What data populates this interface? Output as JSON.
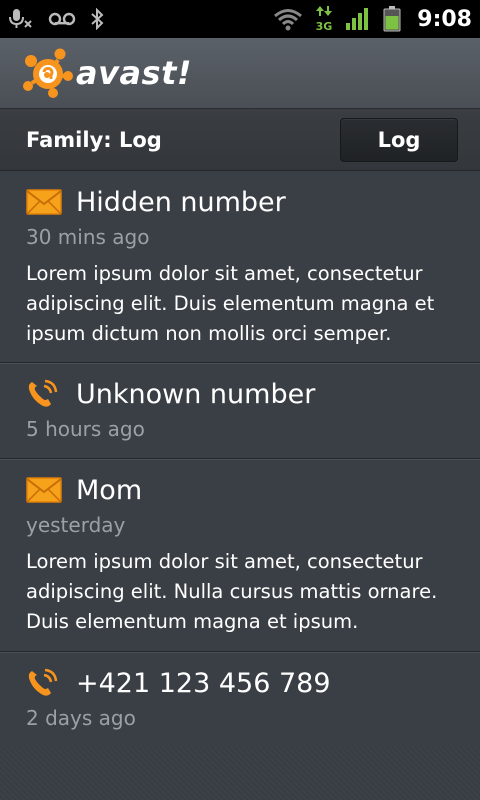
{
  "status_bar": {
    "time": "9:08",
    "network": "3G",
    "icons": [
      "mic-muted-icon",
      "voicemail-icon",
      "bluetooth-icon",
      "wifi-icon",
      "3g-data-icon",
      "signal-icon",
      "battery-icon"
    ]
  },
  "app": {
    "brand": "avast!",
    "brand_color": "#f7941d"
  },
  "section": {
    "title": "Family: Log",
    "button_label": "Log"
  },
  "log_items": [
    {
      "type": "sms",
      "icon": "envelope-icon",
      "title": "Hidden number",
      "time": "30 mins ago",
      "body": "Lorem ipsum dolor sit amet, consectetur adipiscing elit. Duis elementum magna et ipsum dictum non mollis orci semper."
    },
    {
      "type": "call",
      "icon": "phone-icon",
      "title": "Unknown number",
      "time": "5 hours ago"
    },
    {
      "type": "sms",
      "icon": "envelope-icon",
      "title": "Mom",
      "time": "yesterday",
      "body": "Lorem ipsum dolor sit amet, consectetur adipiscing elit. Nulla cursus mattis ornare. Duis elementum magna et ipsum."
    },
    {
      "type": "call",
      "icon": "phone-icon",
      "title": "+421 123 456 789",
      "time": "2 days ago"
    }
  ]
}
